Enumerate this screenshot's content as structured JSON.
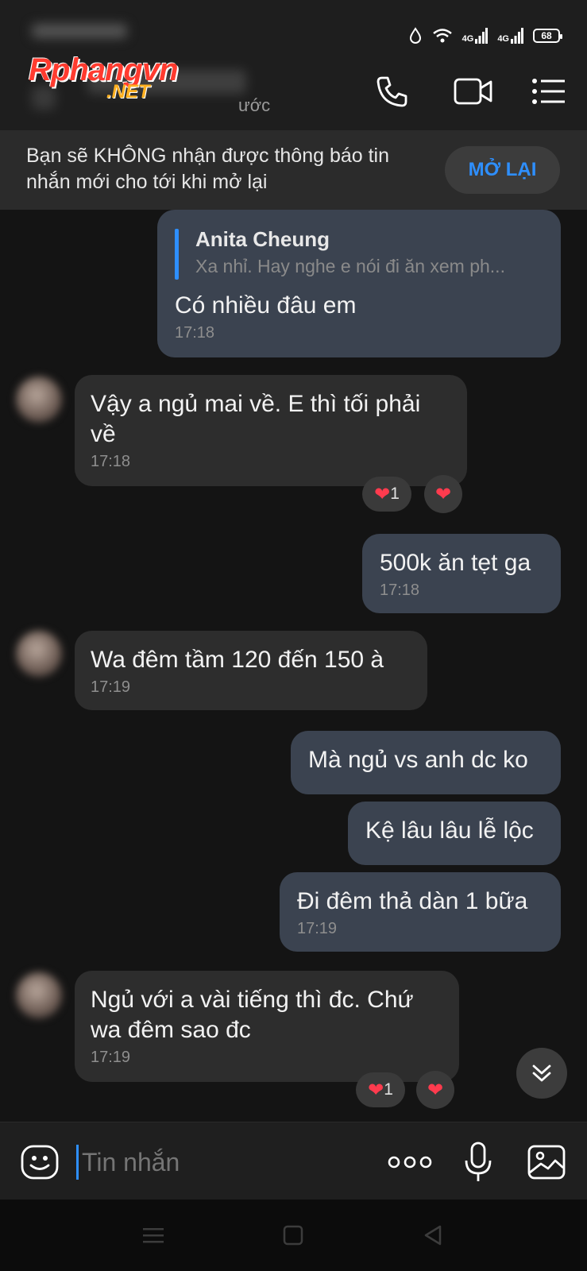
{
  "status_bar": {
    "network_1": "4G",
    "network_2": "4G",
    "battery": "68"
  },
  "header": {
    "watermark_main": "Rphangvn",
    "watermark_net": ".NET",
    "subtitle_fragment": "ước"
  },
  "mute_banner": {
    "text": "Bạn sẽ KHÔNG nhận được thông báo tin nhắn mới cho tới khi mở lại",
    "button": "MỞ LẠI"
  },
  "messages": [
    {
      "direction": "out",
      "quote_author": "Anita Cheung",
      "quote_text": "Xa nhỉ. Hay nghe e nói đi ăn xem ph...",
      "text": "Có nhiều đâu em",
      "time": "17:18"
    },
    {
      "direction": "in",
      "text": "Vậy a ngủ mai về. E thì tối phải về",
      "time": "17:18",
      "reaction_count": "1"
    },
    {
      "direction": "out",
      "text": "500k ăn tẹt ga",
      "time": "17:18"
    },
    {
      "direction": "in",
      "text": "Wa đêm tầm 120 đến 150 à",
      "time": "17:19"
    },
    {
      "direction": "out",
      "text": "Mà ngủ vs anh dc ko",
      "time": ""
    },
    {
      "direction": "out",
      "text": "Kệ lâu lâu lễ lộc",
      "time": ""
    },
    {
      "direction": "out",
      "text": "Đi đêm thả dàn 1 bữa",
      "time": "17:19"
    },
    {
      "direction": "in",
      "text": "Ngủ với a vài tiếng thì đc. Chứ wa đêm sao đc",
      "time": "17:19",
      "reaction_count": "1"
    }
  ],
  "composer": {
    "placeholder": "Tin nhắn"
  },
  "icons": {
    "call": "phone-icon",
    "video": "video-call-icon",
    "menu": "menu-icon",
    "emoji": "sticker-icon",
    "more": "more-dots-icon",
    "mic": "mic-icon",
    "image": "image-icon",
    "scroll": "chevron-double-down-icon"
  },
  "colors": {
    "accent": "#2e8fff",
    "outgoing_bubble": "#3b4350",
    "incoming_bubble": "#2d2d2d",
    "heart": "#ff3b4e"
  }
}
